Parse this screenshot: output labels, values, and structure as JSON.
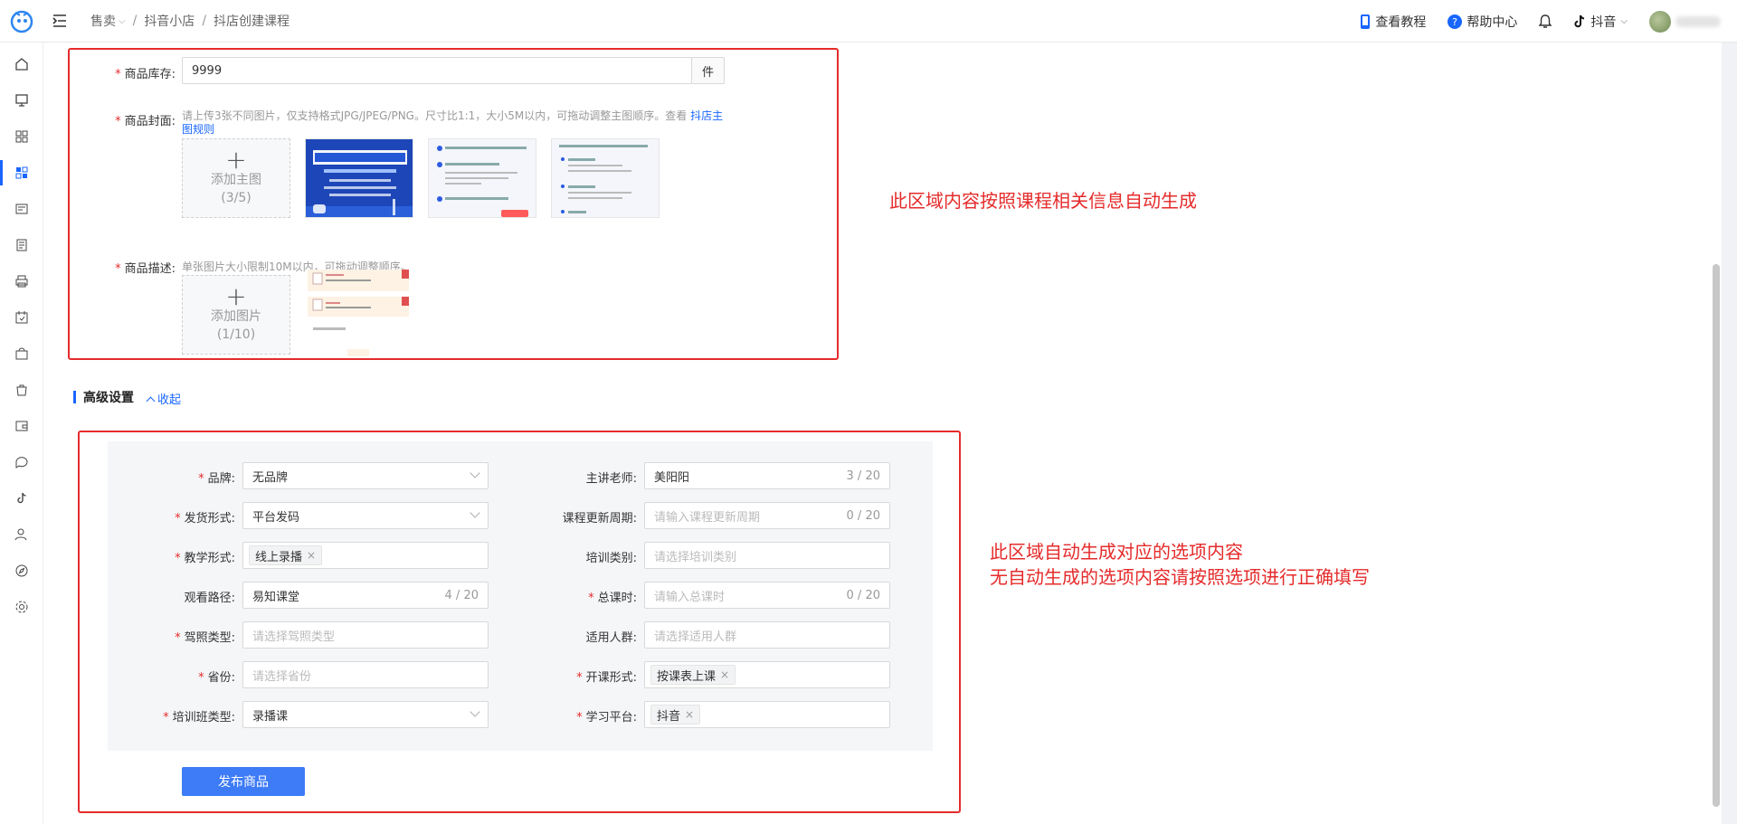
{
  "header": {
    "breadcrumb": [
      "售卖",
      "抖音小店",
      "抖店创建课程"
    ],
    "tutorial_label": "查看教程",
    "help_label": "帮助中心",
    "platform_label": "抖音"
  },
  "product": {
    "stock_label": "商品库存",
    "stock_value": "9999",
    "stock_unit": "件",
    "cover_label": "商品封面",
    "cover_hint": "请上传3张不同图片，仅支持格式JPG/JPEG/PNG。尺寸比1:1，大小5M以内，可拖动调整主图顺序。查看",
    "cover_hint_link": "抖店主图规则",
    "cover_upload_label": "添加主图",
    "cover_upload_count": "(3/5)",
    "desc_label": "商品描述",
    "desc_hint": "单张图片大小限制10M以内，可拖动调整顺序。",
    "desc_upload_label": "添加图片",
    "desc_upload_count": "(1/10)"
  },
  "notes": {
    "top": "此区域内容按照课程相关信息自动生成",
    "bottom_line1": "此区域自动生成对应的选项内容",
    "bottom_line2": "无自动生成的选项内容请按照选项进行正确填写"
  },
  "advanced": {
    "title": "高级设置",
    "collapse_label": "收起",
    "left": [
      {
        "label": "品牌",
        "required": true,
        "value": "无品牌",
        "type": "select"
      },
      {
        "label": "发货形式",
        "required": true,
        "value": "平台发码",
        "type": "select"
      },
      {
        "label": "教学形式",
        "required": true,
        "tag": "线上录播",
        "type": "tags"
      },
      {
        "label": "观看路径",
        "required": false,
        "value": "易知课堂",
        "count": "4 / 20",
        "type": "text"
      },
      {
        "label": "驾照类型",
        "required": true,
        "placeholder": "请选择驾照类型",
        "type": "select-empty"
      },
      {
        "label": "省份",
        "required": true,
        "placeholder": "请选择省份",
        "type": "select-empty"
      },
      {
        "label": "培训班类型",
        "required": true,
        "value": "录播课",
        "type": "select"
      }
    ],
    "right": [
      {
        "label": "主讲老师",
        "required": false,
        "value": "美阳阳",
        "count": "3 / 20",
        "type": "text"
      },
      {
        "label": "课程更新周期",
        "required": false,
        "placeholder": "请输入课程更新周期",
        "count": "0 / 20",
        "type": "text-empty"
      },
      {
        "label": "培训类别",
        "required": false,
        "placeholder": "请选择培训类别",
        "type": "select-empty"
      },
      {
        "label": "总课时",
        "required": true,
        "placeholder": "请输入总课时",
        "count": "0 / 20",
        "type": "text-empty"
      },
      {
        "label": "适用人群",
        "required": false,
        "placeholder": "请选择适用人群",
        "type": "select-empty"
      },
      {
        "label": "开课形式",
        "required": true,
        "tag": "按课表上课",
        "type": "tags"
      },
      {
        "label": "学习平台",
        "required": true,
        "tag": "抖音",
        "type": "tags"
      }
    ],
    "submit_label": "发布商品"
  },
  "colors": {
    "accent": "#1966ff",
    "annotation": "#e52b2b",
    "button": "#3d7bf7"
  }
}
